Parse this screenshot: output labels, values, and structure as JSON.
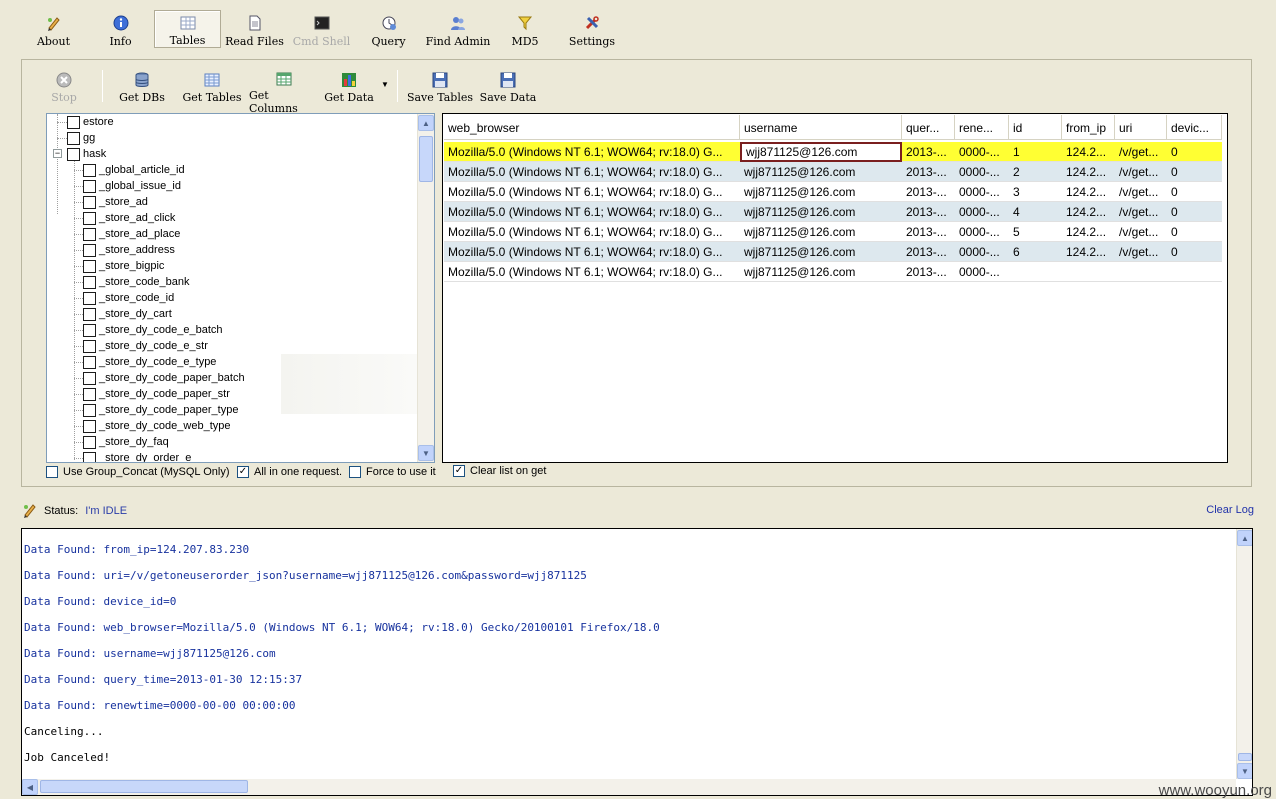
{
  "toolbar": {
    "about": "About",
    "info": "Info",
    "tables": "Tables",
    "read_files": "Read Files",
    "cmd_shell": "Cmd Shell",
    "query": "Query",
    "find_admin": "Find Admin",
    "md5": "MD5",
    "settings": "Settings"
  },
  "subtoolbar": {
    "stop": "Stop",
    "get_dbs": "Get DBs",
    "get_tables": "Get Tables",
    "get_columns": "Get Columns",
    "get_data": "Get Data",
    "save_tables": "Save Tables",
    "save_data": "Save Data"
  },
  "tree": {
    "roots": [
      "estore",
      "gg",
      "hask"
    ],
    "children": [
      "_global_article_id",
      "_global_issue_id",
      "_store_ad",
      "_store_ad_click",
      "_store_ad_place",
      "_store_address",
      "_store_bigpic",
      "_store_code_bank",
      "_store_code_id",
      "_store_dy_cart",
      "_store_dy_code_e_batch",
      "_store_dy_code_e_str",
      "_store_dy_code_e_type",
      "_store_dy_code_paper_batch",
      "_store_dy_code_paper_str",
      "_store_dy_code_paper_type",
      "_store_dy_code_web_type",
      "_store_dy_faq",
      "_store_dy_order_e"
    ]
  },
  "options": {
    "group_concat": "Use Group_Concat (MySQL Only)",
    "all_in_one": "All in one request.",
    "force": "Force to use it",
    "clear_list": "Clear list on get"
  },
  "grid": {
    "columns": [
      "web_browser",
      "username",
      "quer...",
      "rene...",
      "id",
      "from_ip",
      "uri",
      "devic..."
    ],
    "rows": [
      [
        "Mozilla/5.0 (Windows NT 6.1; WOW64; rv:18.0) G...",
        "wjj871125@126.com",
        "2013-...",
        "0000-...",
        "1",
        "124.2...",
        "/v/get...",
        "0"
      ],
      [
        "Mozilla/5.0 (Windows NT 6.1; WOW64; rv:18.0) G...",
        "wjj871125@126.com",
        "2013-...",
        "0000-...",
        "2",
        "124.2...",
        "/v/get...",
        "0"
      ],
      [
        "Mozilla/5.0 (Windows NT 6.1; WOW64; rv:18.0) G...",
        "wjj871125@126.com",
        "2013-...",
        "0000-...",
        "3",
        "124.2...",
        "/v/get...",
        "0"
      ],
      [
        "Mozilla/5.0 (Windows NT 6.1; WOW64; rv:18.0) G...",
        "wjj871125@126.com",
        "2013-...",
        "0000-...",
        "4",
        "124.2...",
        "/v/get...",
        "0"
      ],
      [
        "Mozilla/5.0 (Windows NT 6.1; WOW64; rv:18.0) G...",
        "wjj871125@126.com",
        "2013-...",
        "0000-...",
        "5",
        "124.2...",
        "/v/get...",
        "0"
      ],
      [
        "Mozilla/5.0 (Windows NT 6.1; WOW64; rv:18.0) G...",
        "wjj871125@126.com",
        "2013-...",
        "0000-...",
        "6",
        "124.2...",
        "/v/get...",
        "0"
      ],
      [
        "Mozilla/5.0 (Windows NT 6.1; WOW64; rv:18.0) G...",
        "wjj871125@126.com",
        "2013-...",
        "0000-...",
        "",
        "",
        "",
        ""
      ]
    ]
  },
  "status": {
    "label": "Status:",
    "value": "I'm IDLE",
    "clear_log": "Clear Log"
  },
  "log": [
    "Data Found: from_ip=124.207.83.230",
    "Data Found: uri=/v/getoneuserorder_json?username=wjj871125@126.com&password=wjj871125",
    "Data Found: device_id=0",
    "Data Found: web_browser=Mozilla/5.0 (Windows NT 6.1; WOW64; rv:18.0) Gecko/20100101 Firefox/18.0",
    "Data Found: username=wjj871125@126.com",
    "Data Found: query_time=2013-01-30 12:15:37",
    "Data Found: renewtime=0000-00-00 00:00:00",
    "Canceling...",
    "Job Canceled!"
  ],
  "watermark": "www.wooyun.org",
  "colors": {
    "window_bg": "#ece9d8",
    "selected_row": "#ffff33",
    "alt_row": "#dde8ee",
    "log_found": "#17329e",
    "focus_cell": "#7a1f1f"
  }
}
